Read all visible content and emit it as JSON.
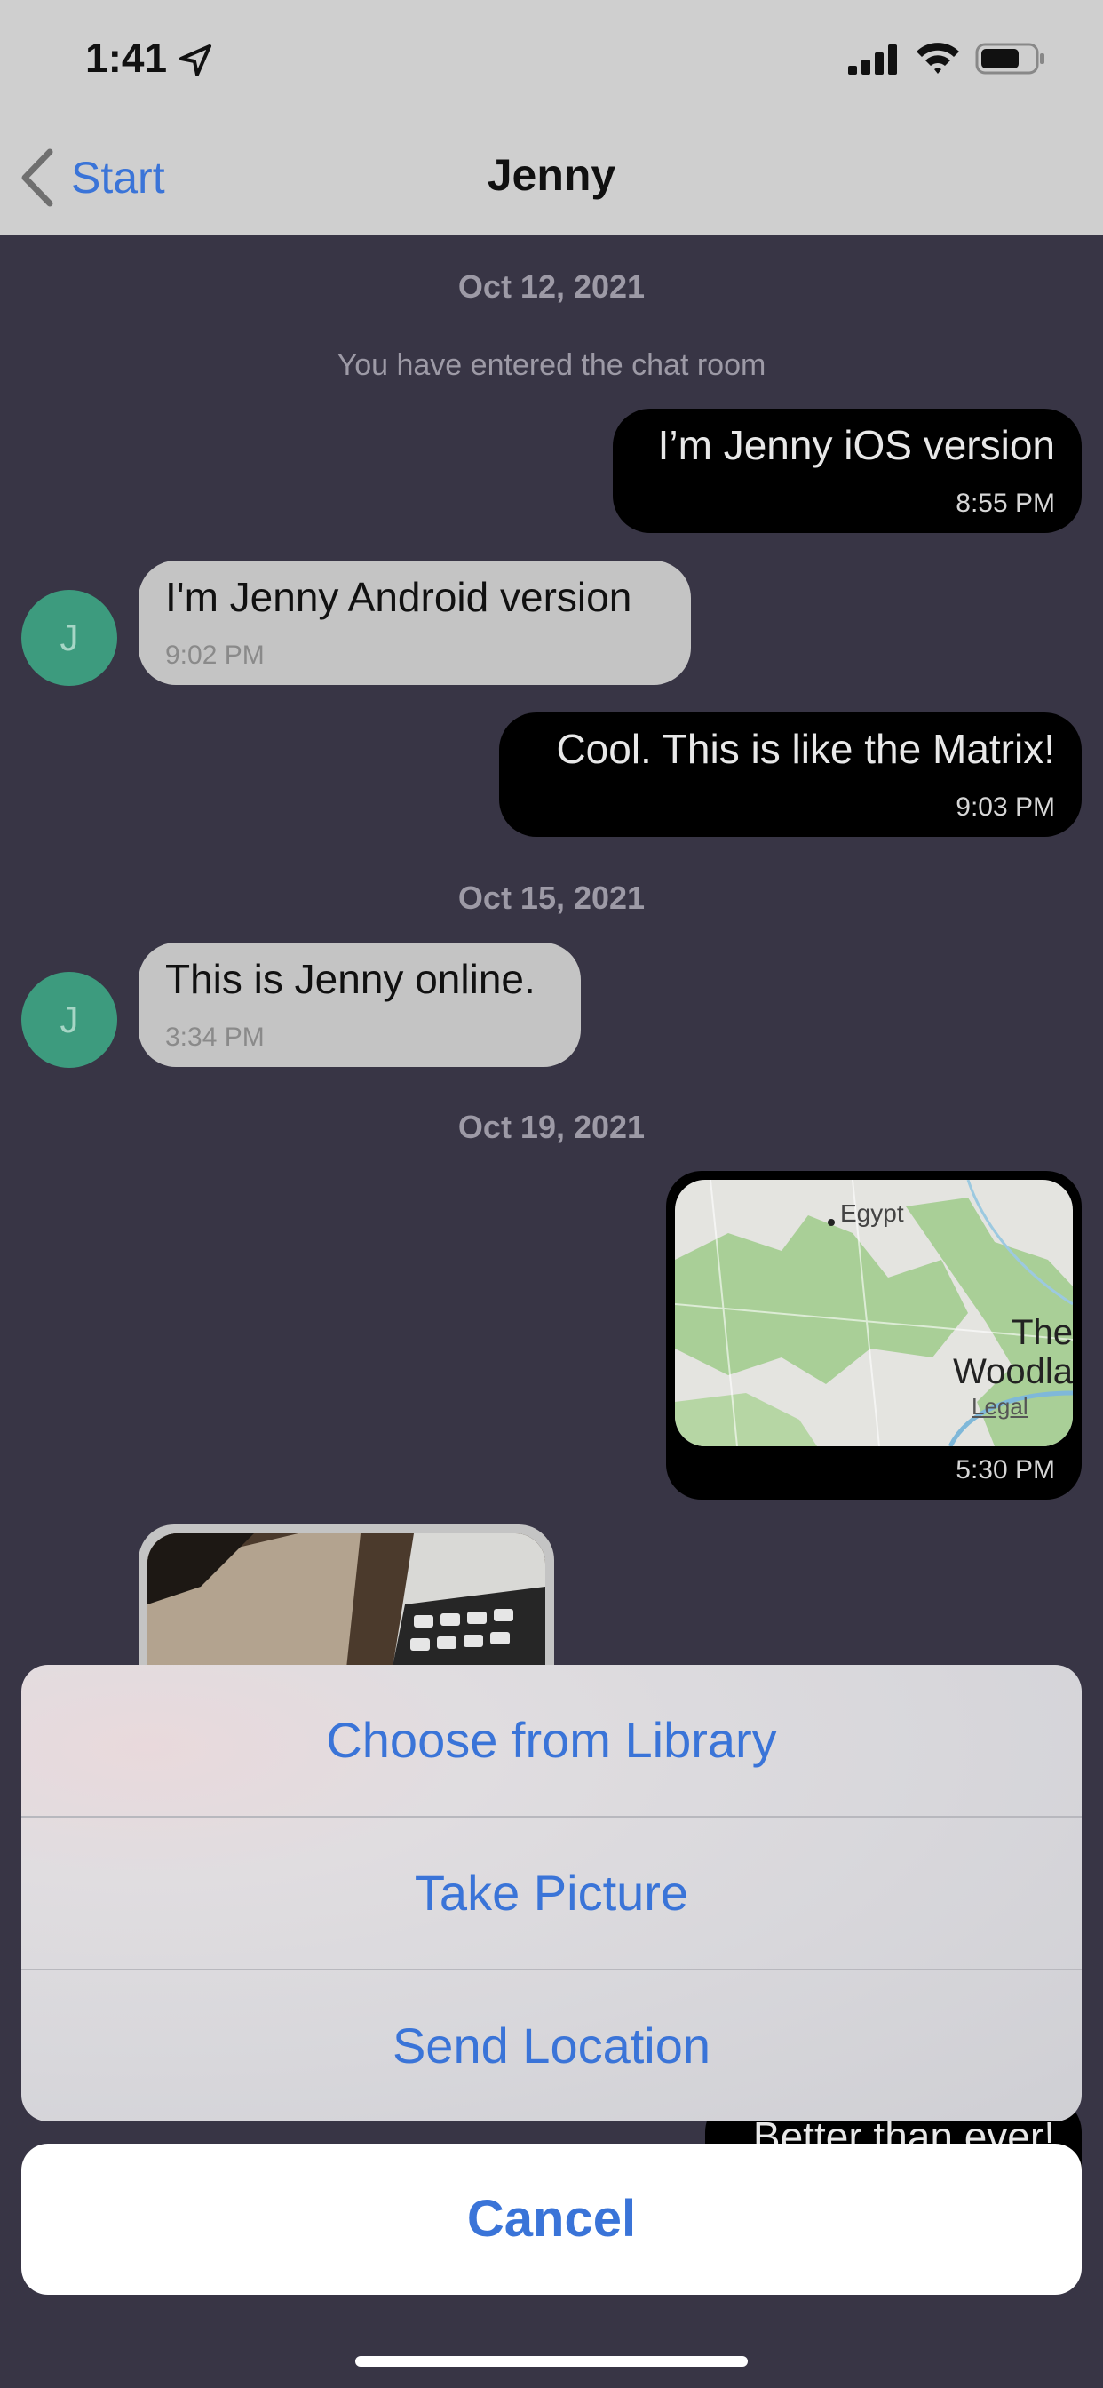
{
  "status_bar": {
    "time": "1:41"
  },
  "nav": {
    "back_label": "Start",
    "title": "Jenny"
  },
  "chat": {
    "date1": "Oct 12, 2021",
    "system_message": "You have entered the chat room",
    "msg1": {
      "text": "I’m Jenny iOS version",
      "time": "8:55 PM"
    },
    "msg2": {
      "avatar": "J",
      "text": "I'm Jenny Android version",
      "time": "9:02 PM"
    },
    "msg3": {
      "text": "Cool. This is like the Matrix!",
      "time": "9:03 PM"
    },
    "date2": "Oct 15, 2021",
    "msg4": {
      "avatar": "J",
      "text": "This is Jenny online.",
      "time": "3:34 PM"
    },
    "date3": "Oct 19, 2021",
    "map_msg": {
      "label_place1": "Egypt",
      "label_place2a": "The",
      "label_place2b": "Woodla",
      "legal": "Legal",
      "time": "5:30 PM"
    },
    "peek_msg": {
      "text": "Better than ever!"
    }
  },
  "action_sheet": {
    "option1": "Choose from Library",
    "option2": "Take Picture",
    "option3": "Send Location",
    "cancel": "Cancel"
  },
  "colors": {
    "accent": "#3a74d8",
    "chat_bg": "#383545",
    "avatar": "#3d9b7e"
  }
}
